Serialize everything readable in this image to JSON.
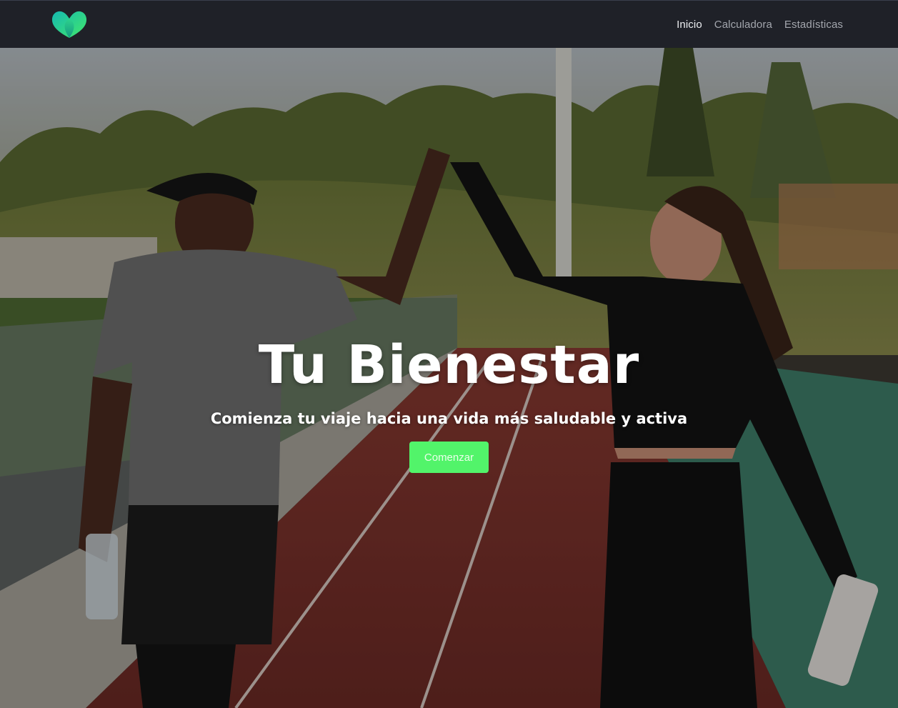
{
  "navbar": {
    "logo_icon": "heart-leaf-logo-icon",
    "links": [
      {
        "label": "Inicio",
        "active": true
      },
      {
        "label": "Calculadora",
        "active": false
      },
      {
        "label": "Estadísticas",
        "active": false
      }
    ]
  },
  "hero": {
    "image": "two-runners-high-five-on-track-photo",
    "title": "Tu Bienestar",
    "subtitle": "Comienza tu viaje hacia una vida más saludable y activa",
    "cta_label": "Comenzar"
  },
  "colors": {
    "navbar_bg": "#1f2128",
    "nav_active": "#eceef1",
    "nav_inactive": "#a3a6ad",
    "accent_green": "#52f46a",
    "logo_teal": "#1fc7a0",
    "logo_green": "#3ee36e"
  }
}
